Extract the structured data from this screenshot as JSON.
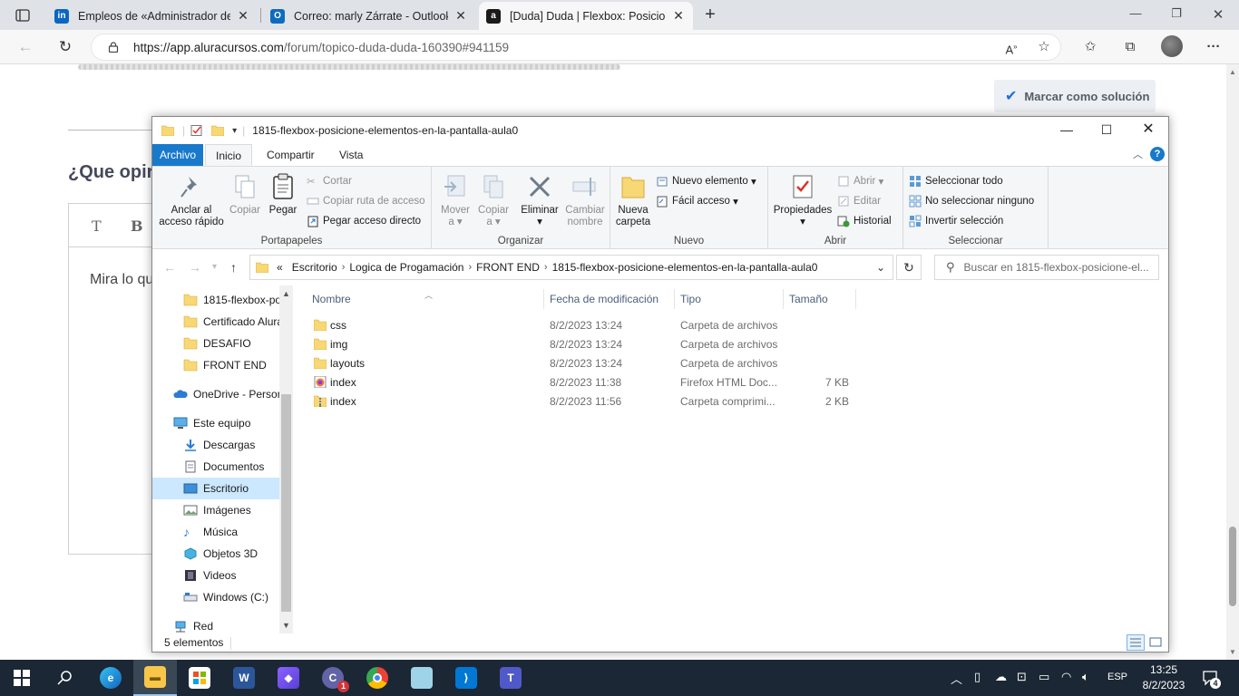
{
  "browser": {
    "tabs": [
      {
        "title": "Empleos de «Administrador de c",
        "favicon": "linkedin-icon",
        "active": false
      },
      {
        "title": "Correo: marly Zárrate - Outlook",
        "favicon": "outlook-icon",
        "active": false
      },
      {
        "title": "[Duda] Duda | Flexbox: Posicione",
        "favicon": "alura-icon",
        "active": true
      }
    ],
    "url_host": "https://app.aluracursos.com",
    "url_path": "/forum/topico-duda-duda-160390#941159"
  },
  "page": {
    "mark_solution": "Marcar como solución",
    "question_heading": "¿Que opir",
    "editor_bold": "B",
    "editor_text_tool": "T",
    "editor_body": "Mira lo qu"
  },
  "explorer": {
    "window_title": "1815-flexbox-posicione-elementos-en-la-pantalla-aula0",
    "ribbon_tabs": [
      "Archivo",
      "Inicio",
      "Compartir",
      "Vista"
    ],
    "groups": {
      "portapapeles": "Portapapeles",
      "organizar": "Organizar",
      "nuevo": "Nuevo",
      "abrir": "Abrir",
      "seleccionar": "Seleccionar"
    },
    "buttons": {
      "anclar_1": "Anclar al",
      "anclar_2": "acceso rápido",
      "copiar": "Copiar",
      "pegar": "Pegar",
      "cortar": "Cortar",
      "copiar_ruta": "Copiar ruta de acceso",
      "pegar_acceso": "Pegar acceso directo",
      "mover_1": "Mover",
      "mover_2": "a",
      "copiar2_1": "Copiar",
      "copiar2_2": "a",
      "eliminar": "Eliminar",
      "cambiar_1": "Cambiar",
      "cambiar_2": "nombre",
      "nueva_1": "Nueva",
      "nueva_2": "carpeta",
      "nuevo_elemento": "Nuevo elemento",
      "facil_acceso": "Fácil acceso",
      "propiedades": "Propiedades",
      "abrir": "Abrir",
      "editar": "Editar",
      "historial": "Historial",
      "seleccionar_todo": "Seleccionar todo",
      "no_seleccionar": "No seleccionar ninguno",
      "invertir": "Invertir selección"
    },
    "breadcrumb": [
      "Escritorio",
      "Logica de Progamación",
      "FRONT END",
      "1815-flexbox-posicione-elementos-en-la-pantalla-aula0"
    ],
    "breadcrumb_prefix": "«",
    "search_placeholder": "Buscar en 1815-flexbox-posicione-el...",
    "nav_items": [
      {
        "label": "1815-flexbox-po",
        "icon": "folder-icon"
      },
      {
        "label": "Certificado Alura",
        "icon": "folder-icon"
      },
      {
        "label": "DESAFIO",
        "icon": "folder-icon"
      },
      {
        "label": "FRONT END",
        "icon": "folder-icon"
      },
      {
        "label": "OneDrive - Person",
        "icon": "onedrive-icon"
      },
      {
        "label": "Este equipo",
        "icon": "computer-icon"
      },
      {
        "label": "Descargas",
        "icon": "downloads-icon"
      },
      {
        "label": "Documentos",
        "icon": "documents-icon"
      },
      {
        "label": "Escritorio",
        "icon": "desktop-icon"
      },
      {
        "label": "Imágenes",
        "icon": "pictures-icon"
      },
      {
        "label": "Música",
        "icon": "music-icon"
      },
      {
        "label": "Objetos 3D",
        "icon": "objects3d-icon"
      },
      {
        "label": "Videos",
        "icon": "videos-icon"
      },
      {
        "label": "Windows (C:)",
        "icon": "drive-icon"
      },
      {
        "label": "Red",
        "icon": "network-icon"
      }
    ],
    "columns": [
      "Nombre",
      "Fecha de modificación",
      "Tipo",
      "Tamaño"
    ],
    "files": [
      {
        "name": "css",
        "date": "8/2/2023 13:24",
        "type": "Carpeta de archivos",
        "size": "",
        "icon": "folder-icon"
      },
      {
        "name": "img",
        "date": "8/2/2023 13:24",
        "type": "Carpeta de archivos",
        "size": "",
        "icon": "folder-icon"
      },
      {
        "name": "layouts",
        "date": "8/2/2023 13:24",
        "type": "Carpeta de archivos",
        "size": "",
        "icon": "folder-icon"
      },
      {
        "name": "index",
        "date": "8/2/2023 11:38",
        "type": "Firefox HTML Doc...",
        "size": "7 KB",
        "icon": "firefox-html-icon"
      },
      {
        "name": "index",
        "date": "8/2/2023 11:56",
        "type": "Carpeta comprimi...",
        "size": "2 KB",
        "icon": "zip-folder-icon"
      }
    ],
    "status": "5 elementos"
  },
  "taskbar": {
    "apps": [
      "start-icon",
      "search-icon",
      "edge-icon",
      "file-explorer-icon",
      "store-icon",
      "word-icon",
      "teams-chat-icon",
      "teams-icon",
      "chrome-icon",
      "notepad-icon",
      "vscode-icon",
      "teams-icon-2"
    ],
    "badge_count": "1",
    "lang": "ESP",
    "time": "13:25",
    "date": "8/2/2023",
    "notifications": "4"
  }
}
